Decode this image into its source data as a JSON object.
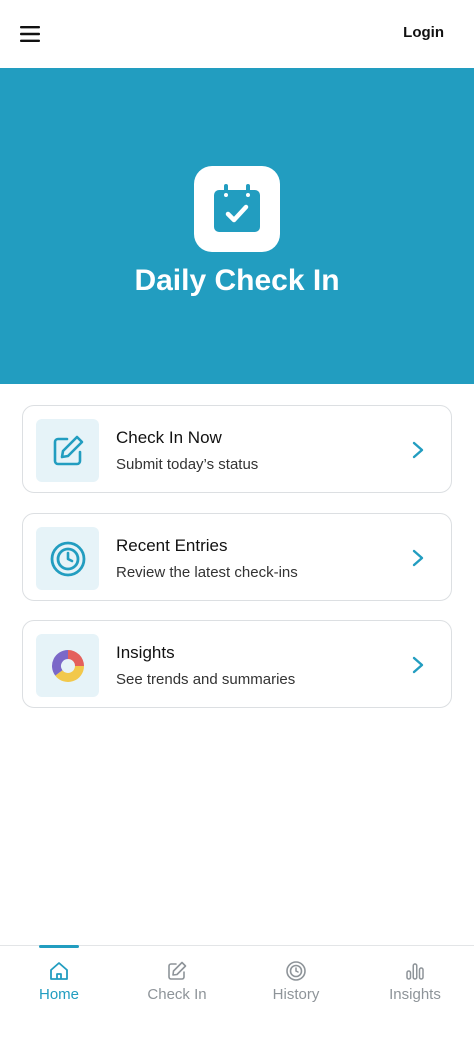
{
  "header": {
    "login_label": "Login"
  },
  "hero": {
    "title": "Daily Check In",
    "icon": "calendar-check-icon",
    "background_color": "#229dc0"
  },
  "cards": [
    {
      "title": "Check In Now",
      "subtitle": "Submit today’s status",
      "icon": "edit-icon"
    },
    {
      "title": "Recent Entries",
      "subtitle": "Review the latest check-ins",
      "icon": "clock-icon"
    },
    {
      "title": "Insights",
      "subtitle": "See trends and summaries",
      "icon": "donut-chart-icon"
    }
  ],
  "bottom_nav": {
    "items": [
      {
        "label": "Home",
        "icon": "home-icon",
        "active": true
      },
      {
        "label": "Check In",
        "icon": "edit-icon",
        "active": false
      },
      {
        "label": "History",
        "icon": "clock-icon",
        "active": false
      },
      {
        "label": "Insights",
        "icon": "bar-chart-icon",
        "active": false
      }
    ]
  },
  "colors": {
    "accent": "#229dc0",
    "icon_tile": "#e6f3f8",
    "inactive": "#8e9499"
  }
}
